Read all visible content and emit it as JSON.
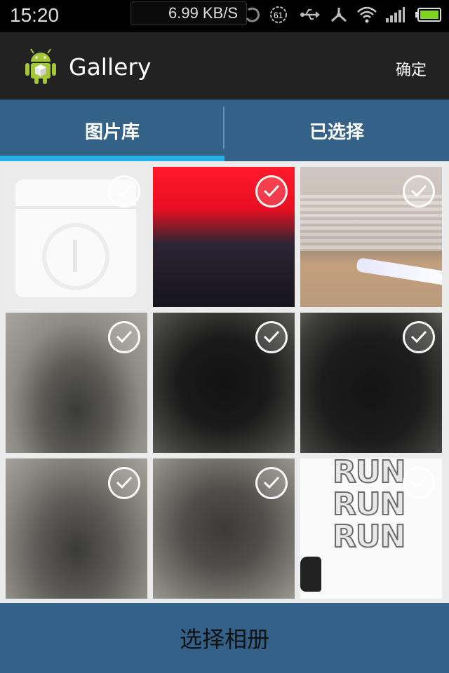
{
  "status_bar": {
    "time": "15:20",
    "net_speed": "6.99 KB/S",
    "battery_icon": "battery-icon",
    "signal_icon": "signal-icon",
    "wifi_icon": "wifi-icon",
    "usb_icon": "usb-icon"
  },
  "action_bar": {
    "title": "Gallery",
    "confirm_label": "确定",
    "app_icon": "android-gallery-icon"
  },
  "tabs": [
    {
      "label": "图片库",
      "selected": true
    },
    {
      "label": "已选择",
      "selected": false
    }
  ],
  "colors": {
    "accent": "#28b1e6",
    "tab_bar": "#336188",
    "action_bar": "#222222"
  },
  "grid_text": {
    "run_lines": [
      "RUN",
      "RUN",
      "RUN"
    ]
  },
  "bottom_button": {
    "label": "选择相册"
  }
}
